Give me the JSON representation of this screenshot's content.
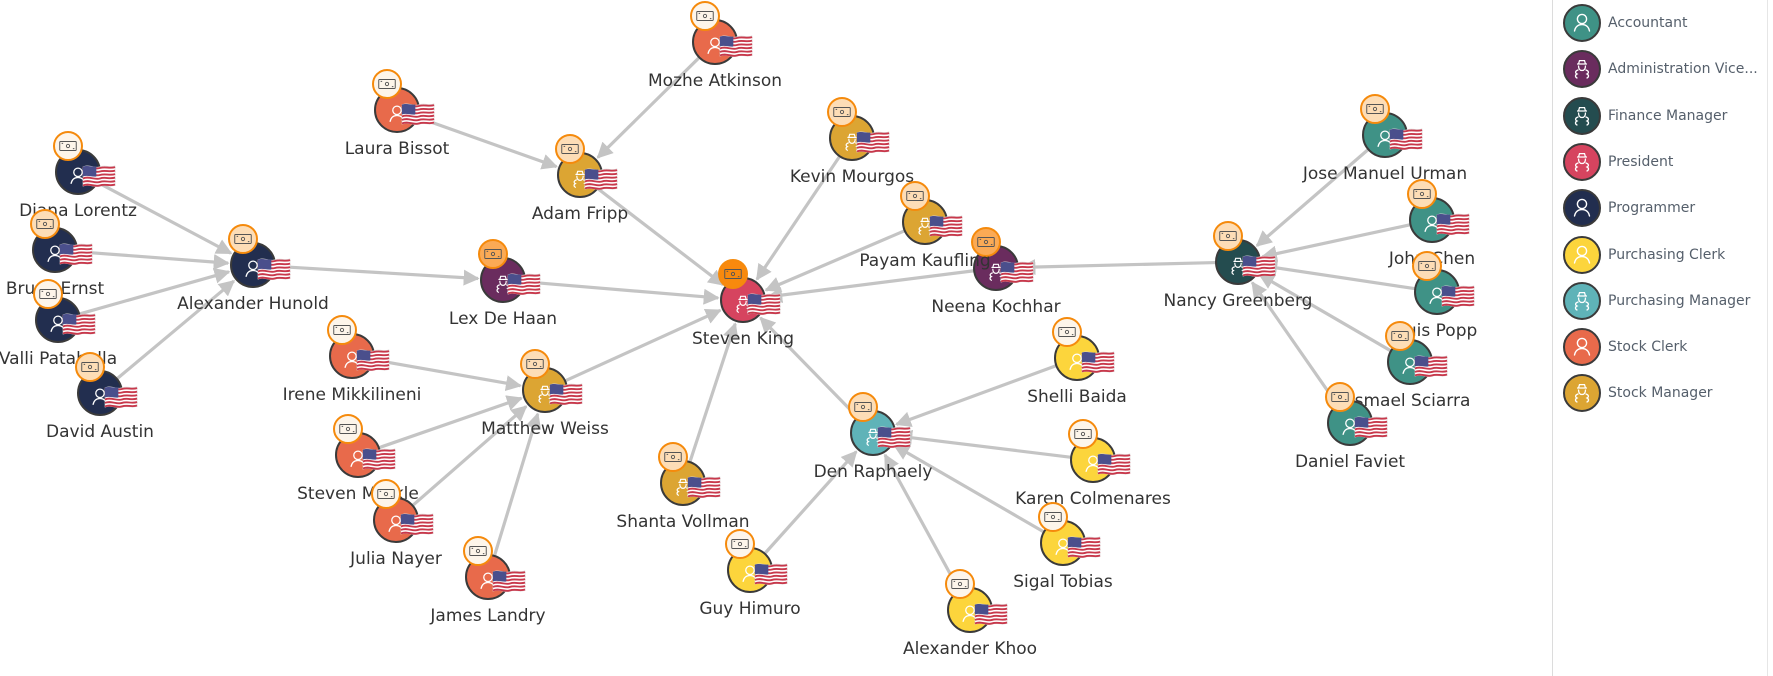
{
  "legend": {
    "items": [
      {
        "label": "Accountant",
        "color": "#3f9286",
        "icon": "person-icon"
      },
      {
        "label": "Administration Vice...",
        "color": "#6a2c5e",
        "icon": "manager-icon"
      },
      {
        "label": "Finance Manager",
        "color": "#244c4f",
        "icon": "manager-icon"
      },
      {
        "label": "President",
        "color": "#d6445f",
        "icon": "manager-icon"
      },
      {
        "label": "Programmer",
        "color": "#222e4f",
        "icon": "person-icon"
      },
      {
        "label": "Purchasing Clerk",
        "color": "#fcd53c",
        "icon": "person-icon"
      },
      {
        "label": "Purchasing Manager",
        "color": "#5fb3b8",
        "icon": "manager-icon"
      },
      {
        "label": "Stock Clerk",
        "color": "#e86a4b",
        "icon": "person-icon"
      },
      {
        "label": "Stock Manager",
        "color": "#dca533",
        "icon": "manager-icon"
      }
    ]
  },
  "badge_levels": {
    "low": "#fdf5ea",
    "mid": "#fdddb6",
    "high": "#fbaa55",
    "top": "#f8890d"
  },
  "country_flag": "US",
  "nodes": [
    {
      "id": "steven-king",
      "name": "Steven King",
      "role": "President",
      "badge": "top"
    },
    {
      "id": "neena-kochhar",
      "name": "Neena Kochhar",
      "role": "Administration Vice...",
      "badge": "high"
    },
    {
      "id": "lex-de-haan",
      "name": "Lex De Haan",
      "role": "Administration Vice...",
      "badge": "high"
    },
    {
      "id": "alexander-hunold",
      "name": "Alexander Hunold",
      "role": "Programmer",
      "badge": "mid"
    },
    {
      "id": "diana-lorentz",
      "name": "Diana Lorentz",
      "role": "Programmer",
      "badge": "low"
    },
    {
      "id": "bruce-ernst",
      "name": "Bruce Ernst",
      "role": "Programmer",
      "badge": "mid"
    },
    {
      "id": "valli-pataballa",
      "name": "Valli Pataballa",
      "role": "Programmer",
      "badge": "low"
    },
    {
      "id": "david-austin",
      "name": "David Austin",
      "role": "Programmer",
      "badge": "mid"
    },
    {
      "id": "nancy-greenberg",
      "name": "Nancy Greenberg",
      "role": "Finance Manager",
      "badge": "mid"
    },
    {
      "id": "jose-manuel-urman",
      "name": "Jose Manuel Urman",
      "role": "Accountant",
      "badge": "mid"
    },
    {
      "id": "john-chen",
      "name": "John Chen",
      "role": "Accountant",
      "badge": "mid"
    },
    {
      "id": "luis-popp",
      "name": "Luis Popp",
      "role": "Accountant",
      "badge": "mid"
    },
    {
      "id": "ismael-sciarra",
      "name": "Ismael Sciarra",
      "role": "Accountant",
      "badge": "mid"
    },
    {
      "id": "daniel-faviet",
      "name": "Daniel Faviet",
      "role": "Accountant",
      "badge": "mid"
    },
    {
      "id": "den-raphaely",
      "name": "Den Raphaely",
      "role": "Purchasing Manager",
      "badge": "mid"
    },
    {
      "id": "shelli-baida",
      "name": "Shelli Baida",
      "role": "Purchasing Clerk",
      "badge": "low"
    },
    {
      "id": "karen-colmenares",
      "name": "Karen Colmenares",
      "role": "Purchasing Clerk",
      "badge": "low"
    },
    {
      "id": "sigal-tobias",
      "name": "Sigal Tobias",
      "role": "Purchasing Clerk",
      "badge": "low"
    },
    {
      "id": "alexander-khoo",
      "name": "Alexander Khoo",
      "role": "Purchasing Clerk",
      "badge": "low"
    },
    {
      "id": "guy-himuro",
      "name": "Guy Himuro",
      "role": "Purchasing Clerk",
      "badge": "low"
    },
    {
      "id": "matthew-weiss",
      "name": "Matthew Weiss",
      "role": "Stock Manager",
      "badge": "mid"
    },
    {
      "id": "adam-fripp",
      "name": "Adam Fripp",
      "role": "Stock Manager",
      "badge": "mid"
    },
    {
      "id": "kevin-mourgos",
      "name": "Kevin Mourgos",
      "role": "Stock Manager",
      "badge": "mid"
    },
    {
      "id": "payam-kaufling",
      "name": "Payam Kaufling",
      "role": "Stock Manager",
      "badge": "mid"
    },
    {
      "id": "shanta-vollman",
      "name": "Shanta Vollman",
      "role": "Stock Manager",
      "badge": "mid"
    },
    {
      "id": "irene-mikkilineni",
      "name": "Irene Mikkilineni",
      "role": "Stock Clerk",
      "badge": "low"
    },
    {
      "id": "steven-markle",
      "name": "Steven Markle",
      "role": "Stock Clerk",
      "badge": "low"
    },
    {
      "id": "julia-nayer",
      "name": "Julia Nayer",
      "role": "Stock Clerk",
      "badge": "low"
    },
    {
      "id": "james-landry",
      "name": "James Landry",
      "role": "Stock Clerk",
      "badge": "low"
    },
    {
      "id": "laura-bissot",
      "name": "Laura Bissot",
      "role": "Stock Clerk",
      "badge": "low"
    },
    {
      "id": "mozhe-atkinson",
      "name": "Mozhe Atkinson",
      "role": "Stock Clerk",
      "badge": "low"
    }
  ],
  "edges": [
    {
      "from": "diana-lorentz",
      "to": "alexander-hunold"
    },
    {
      "from": "bruce-ernst",
      "to": "alexander-hunold"
    },
    {
      "from": "valli-pataballa",
      "to": "alexander-hunold"
    },
    {
      "from": "david-austin",
      "to": "alexander-hunold"
    },
    {
      "from": "alexander-hunold",
      "to": "lex-de-haan"
    },
    {
      "from": "lex-de-haan",
      "to": "steven-king"
    },
    {
      "from": "laura-bissot",
      "to": "adam-fripp"
    },
    {
      "from": "mozhe-atkinson",
      "to": "adam-fripp"
    },
    {
      "from": "adam-fripp",
      "to": "steven-king"
    },
    {
      "from": "kevin-mourgos",
      "to": "steven-king"
    },
    {
      "from": "payam-kaufling",
      "to": "steven-king"
    },
    {
      "from": "neena-kochhar",
      "to": "steven-king"
    },
    {
      "from": "nancy-greenberg",
      "to": "neena-kochhar"
    },
    {
      "from": "jose-manuel-urman",
      "to": "nancy-greenberg"
    },
    {
      "from": "john-chen",
      "to": "nancy-greenberg"
    },
    {
      "from": "luis-popp",
      "to": "nancy-greenberg"
    },
    {
      "from": "ismael-sciarra",
      "to": "nancy-greenberg"
    },
    {
      "from": "daniel-faviet",
      "to": "nancy-greenberg"
    },
    {
      "from": "irene-mikkilineni",
      "to": "matthew-weiss"
    },
    {
      "from": "steven-markle",
      "to": "matthew-weiss"
    },
    {
      "from": "julia-nayer",
      "to": "matthew-weiss"
    },
    {
      "from": "james-landry",
      "to": "matthew-weiss"
    },
    {
      "from": "matthew-weiss",
      "to": "steven-king"
    },
    {
      "from": "shanta-vollman",
      "to": "steven-king"
    },
    {
      "from": "den-raphaely",
      "to": "steven-king"
    },
    {
      "from": "shelli-baida",
      "to": "den-raphaely"
    },
    {
      "from": "karen-colmenares",
      "to": "den-raphaely"
    },
    {
      "from": "sigal-tobias",
      "to": "den-raphaely"
    },
    {
      "from": "alexander-khoo",
      "to": "den-raphaely"
    },
    {
      "from": "guy-himuro",
      "to": "den-raphaely"
    }
  ]
}
